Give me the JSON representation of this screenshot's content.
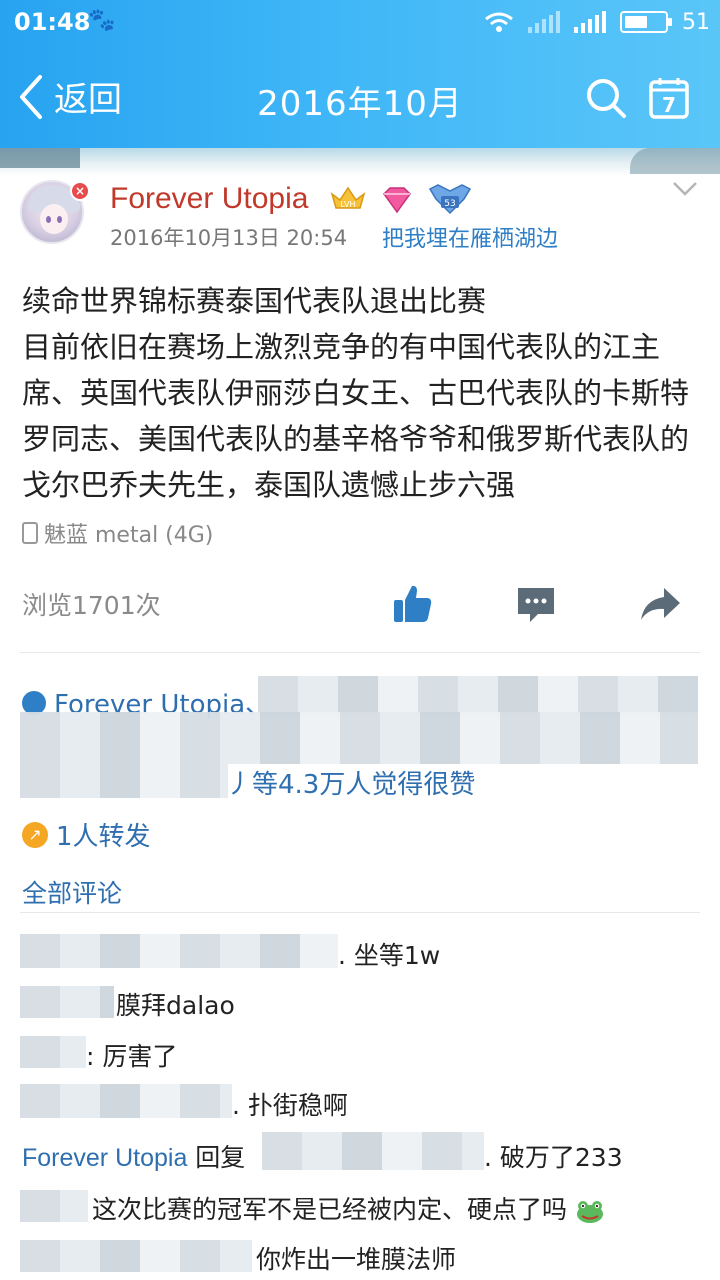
{
  "status_bar": {
    "time": "01:48",
    "network": "4G",
    "battery": "51"
  },
  "nav": {
    "back_label": "返回",
    "title": "2016年10月"
  },
  "post": {
    "author": "Forever Utopia",
    "level_badge": "LVH",
    "rank_badge": "53",
    "time": "2016年10月13日 20:54",
    "location": "把我埋在雁栖湖边",
    "content_lines": [
      "续命世界锦标赛泰国代表队退出比赛",
      "目前依旧在赛场上激烈竞争的有中国代表队的江主席、英国代表队伊丽莎白女王、古巴代表队的卡斯特罗同志、美国代表队的基辛格爷爷和俄罗斯代表队的戈尔巴乔夫先生，泰国队遗憾止步六强"
    ],
    "device": "魅蓝 metal (4G)",
    "views": "浏览1701次"
  },
  "interactions": {
    "likers_first": "Forever Utopia、",
    "likers_tail": "丿等4.3万人觉得很赞",
    "repost": "1人转发"
  },
  "comments_tab": "全部评论",
  "comments": [
    {
      "text": ". 坐等1w"
    },
    {
      "text": "膜拜dalao"
    },
    {
      "text": ": 厉害了"
    },
    {
      "text": ". 扑街稳啊"
    },
    {
      "who": "Forever Utopia",
      "reply": " 回复 ",
      "text": ". 破万了233"
    },
    {
      "text": "这次比赛的冠军不是已经被内定、硬点了吗"
    },
    {
      "text": "你炸出一堆膜法师"
    }
  ],
  "colors": {
    "header_blue": "#27a3f0",
    "link_blue": "#2f6fb0",
    "author_red": "#c0392b"
  }
}
